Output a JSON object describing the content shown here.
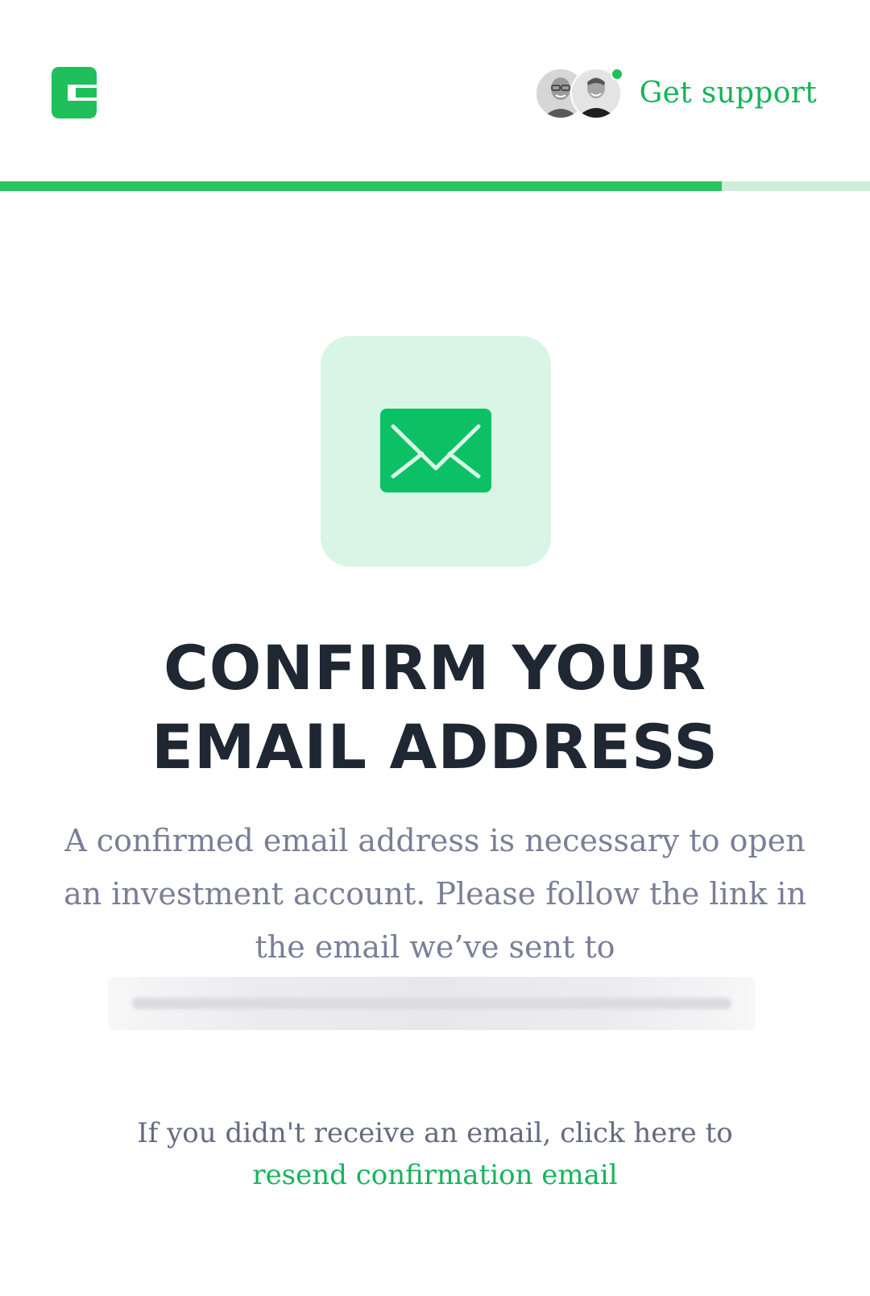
{
  "header": {
    "support_label": "Get support"
  },
  "progress": {
    "fraction": 0.83
  },
  "hero": {
    "icon": "envelope-icon",
    "title": "CONFIRM YOUR EMAIL ADDRESS",
    "description": "A confirmed email address is necessary to open an investment account. Please follow the link in the email we’ve sent to"
  },
  "resend": {
    "prompt": "If you didn't receive an email, click here to",
    "link_label": "resend confirmation email"
  },
  "colors": {
    "brand_green": "#15b45b",
    "progress_track": "#cdeed9",
    "icon_tile": "#d9f5e6",
    "title": "#1e2732",
    "body_text": "#7a7f96"
  }
}
